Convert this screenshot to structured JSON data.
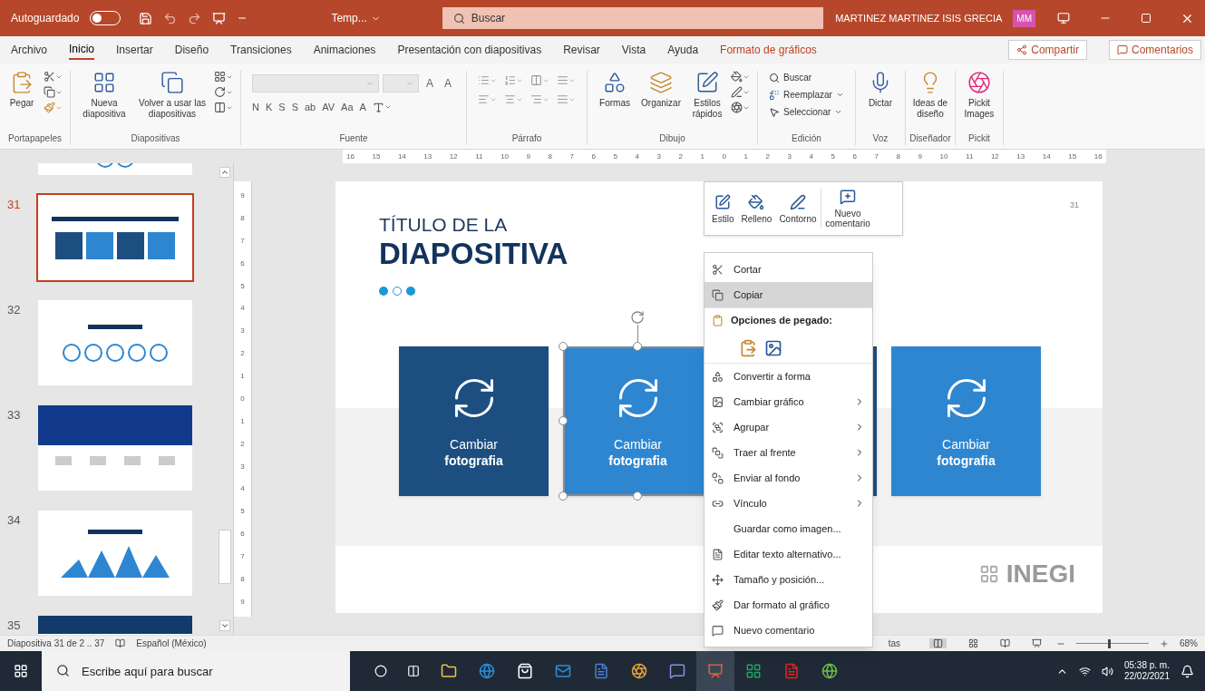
{
  "titlebar": {
    "autosave_label": "Autoguardado",
    "autosave_on": false,
    "doc_title": "Temp...",
    "search_placeholder": "Buscar",
    "user": "MARTINEZ MARTINEZ ISIS GRECIA",
    "avatar": "MM"
  },
  "tabs": [
    {
      "label": "Archivo",
      "selected": false,
      "contextual": false
    },
    {
      "label": "Inicio",
      "selected": true,
      "contextual": false
    },
    {
      "label": "Insertar",
      "selected": false,
      "contextual": false
    },
    {
      "label": "Diseño",
      "selected": false,
      "contextual": false
    },
    {
      "label": "Transiciones",
      "selected": false,
      "contextual": false
    },
    {
      "label": "Animaciones",
      "selected": false,
      "contextual": false
    },
    {
      "label": "Presentación con diapositivas",
      "selected": false,
      "contextual": false
    },
    {
      "label": "Revisar",
      "selected": false,
      "contextual": false
    },
    {
      "label": "Vista",
      "selected": false,
      "contextual": false
    },
    {
      "label": "Ayuda",
      "selected": false,
      "contextual": false
    },
    {
      "label": "Formato de gráficos",
      "selected": false,
      "contextual": true
    }
  ],
  "share_button": "Compartir",
  "comments_button": "Comentarios",
  "ribbon": {
    "groups": [
      {
        "kind": "clipboard",
        "label": "Portapapeles",
        "buttons": [
          "Pegar"
        ]
      },
      {
        "kind": "slides",
        "label": "Diapositivas",
        "buttons": [
          "Nueva diapositiva",
          "Volver a usar las diapositivas"
        ]
      },
      {
        "kind": "font",
        "label": "Fuente",
        "buttons": [
          "A",
          "A",
          "N",
          "K",
          "S",
          "S",
          "ab",
          "AV",
          "Aa",
          "A"
        ]
      },
      {
        "kind": "paragraph",
        "label": "Párrafo"
      },
      {
        "kind": "drawing",
        "label": "Dibujo",
        "buttons": [
          "Formas",
          "Organizar",
          "Estilos rápidos"
        ]
      },
      {
        "kind": "editing",
        "label": "Edición",
        "buttons": [
          "Buscar",
          "Reemplazar",
          "Seleccionar"
        ]
      },
      {
        "kind": "voice",
        "label": "Voz",
        "buttons": [
          "Dictar"
        ]
      },
      {
        "kind": "designer",
        "label": "Diseñador",
        "buttons": [
          "Ideas de diseño"
        ]
      },
      {
        "kind": "addin",
        "label": "Pickit",
        "buttons": [
          "Pickit Images"
        ]
      }
    ]
  },
  "ruler": {
    "horizontal": [
      "16",
      "15",
      "14",
      "13",
      "12",
      "11",
      "10",
      "9",
      "8",
      "7",
      "6",
      "5",
      "4",
      "3",
      "2",
      "1",
      "0",
      "1",
      "2",
      "3",
      "4",
      "5",
      "6",
      "7",
      "8",
      "9",
      "10",
      "11",
      "12",
      "13",
      "14",
      "15",
      "16"
    ],
    "vertical": [
      "9",
      "8",
      "7",
      "6",
      "5",
      "4",
      "3",
      "2",
      "1",
      "0",
      "1",
      "2",
      "3",
      "4",
      "5",
      "6",
      "7",
      "8",
      "9"
    ]
  },
  "thumbnails": [
    {
      "selected": false
    },
    {
      "number": "31",
      "selected": true
    },
    {
      "number": "32",
      "selected": false
    },
    {
      "number": "33",
      "selected": false
    },
    {
      "number": "34",
      "selected": false
    },
    {
      "number": "35",
      "selected": false
    }
  ],
  "slide": {
    "number": "31",
    "title_line1": "TÍTULO DE LA",
    "title_line2": "DIAPOSITIVA",
    "logo": "INEGI",
    "tiles": [
      {
        "color": "#1d4e80",
        "selected": false,
        "line1": "Cambiar",
        "line2": "fotografia"
      },
      {
        "color": "#2e86d0",
        "selected": true,
        "line1": "Cambiar",
        "line2": "fotografia"
      },
      {
        "color": "#1d4e80"
      },
      {
        "color": "#2e86d0",
        "selected": false,
        "line1": "Cambiar",
        "line2": "fotografia"
      }
    ]
  },
  "mini_toolbar": [
    "Estilo",
    "Relleno",
    "Contorno",
    "Nuevo comentario"
  ],
  "context_menu": [
    {
      "kind": "item",
      "label": "Cortar",
      "selected": false,
      "submenu": false
    },
    {
      "kind": "item",
      "label": "Copiar",
      "selected": true,
      "submenu": false
    },
    {
      "kind": "header",
      "label": "Opciones de pegado:"
    },
    {
      "kind": "paste"
    },
    {
      "kind": "item",
      "label": "Convertir a forma",
      "selected": false,
      "submenu": false
    },
    {
      "kind": "item",
      "label": "Cambiar gráfico",
      "selected": false,
      "submenu": true
    },
    {
      "kind": "item",
      "label": "Agrupar",
      "selected": false,
      "submenu": true
    },
    {
      "kind": "item",
      "label": "Traer al frente",
      "selected": false,
      "submenu": true
    },
    {
      "kind": "item",
      "label": "Enviar al fondo",
      "selected": false,
      "submenu": true
    },
    {
      "kind": "item",
      "label": "Vínculo",
      "selected": false,
      "submenu": true
    },
    {
      "kind": "item",
      "label": "Guardar como imagen...",
      "selected": false,
      "submenu": false
    },
    {
      "kind": "item",
      "label": "Editar texto alternativo...",
      "selected": false,
      "submenu": false
    },
    {
      "kind": "item",
      "label": "Tamaño y posición...",
      "selected": false,
      "submenu": false
    },
    {
      "kind": "item",
      "label": "Dar formato al gráfico",
      "selected": false,
      "submenu": false
    },
    {
      "kind": "item",
      "label": "Nuevo comentario",
      "selected": false,
      "submenu": false
    }
  ],
  "status_bar": {
    "slide_info": "Diapositiva 31 de 2 .. 37",
    "language": "Español (México)",
    "notes": "tas",
    "zoom": "68%",
    "zoom_slider": {
      "level": 0.45
    }
  },
  "taskbar": {
    "search_placeholder": "Escribe aquí para buscar",
    "time": "05:38 p. m.",
    "date": "22/02/2021"
  }
}
